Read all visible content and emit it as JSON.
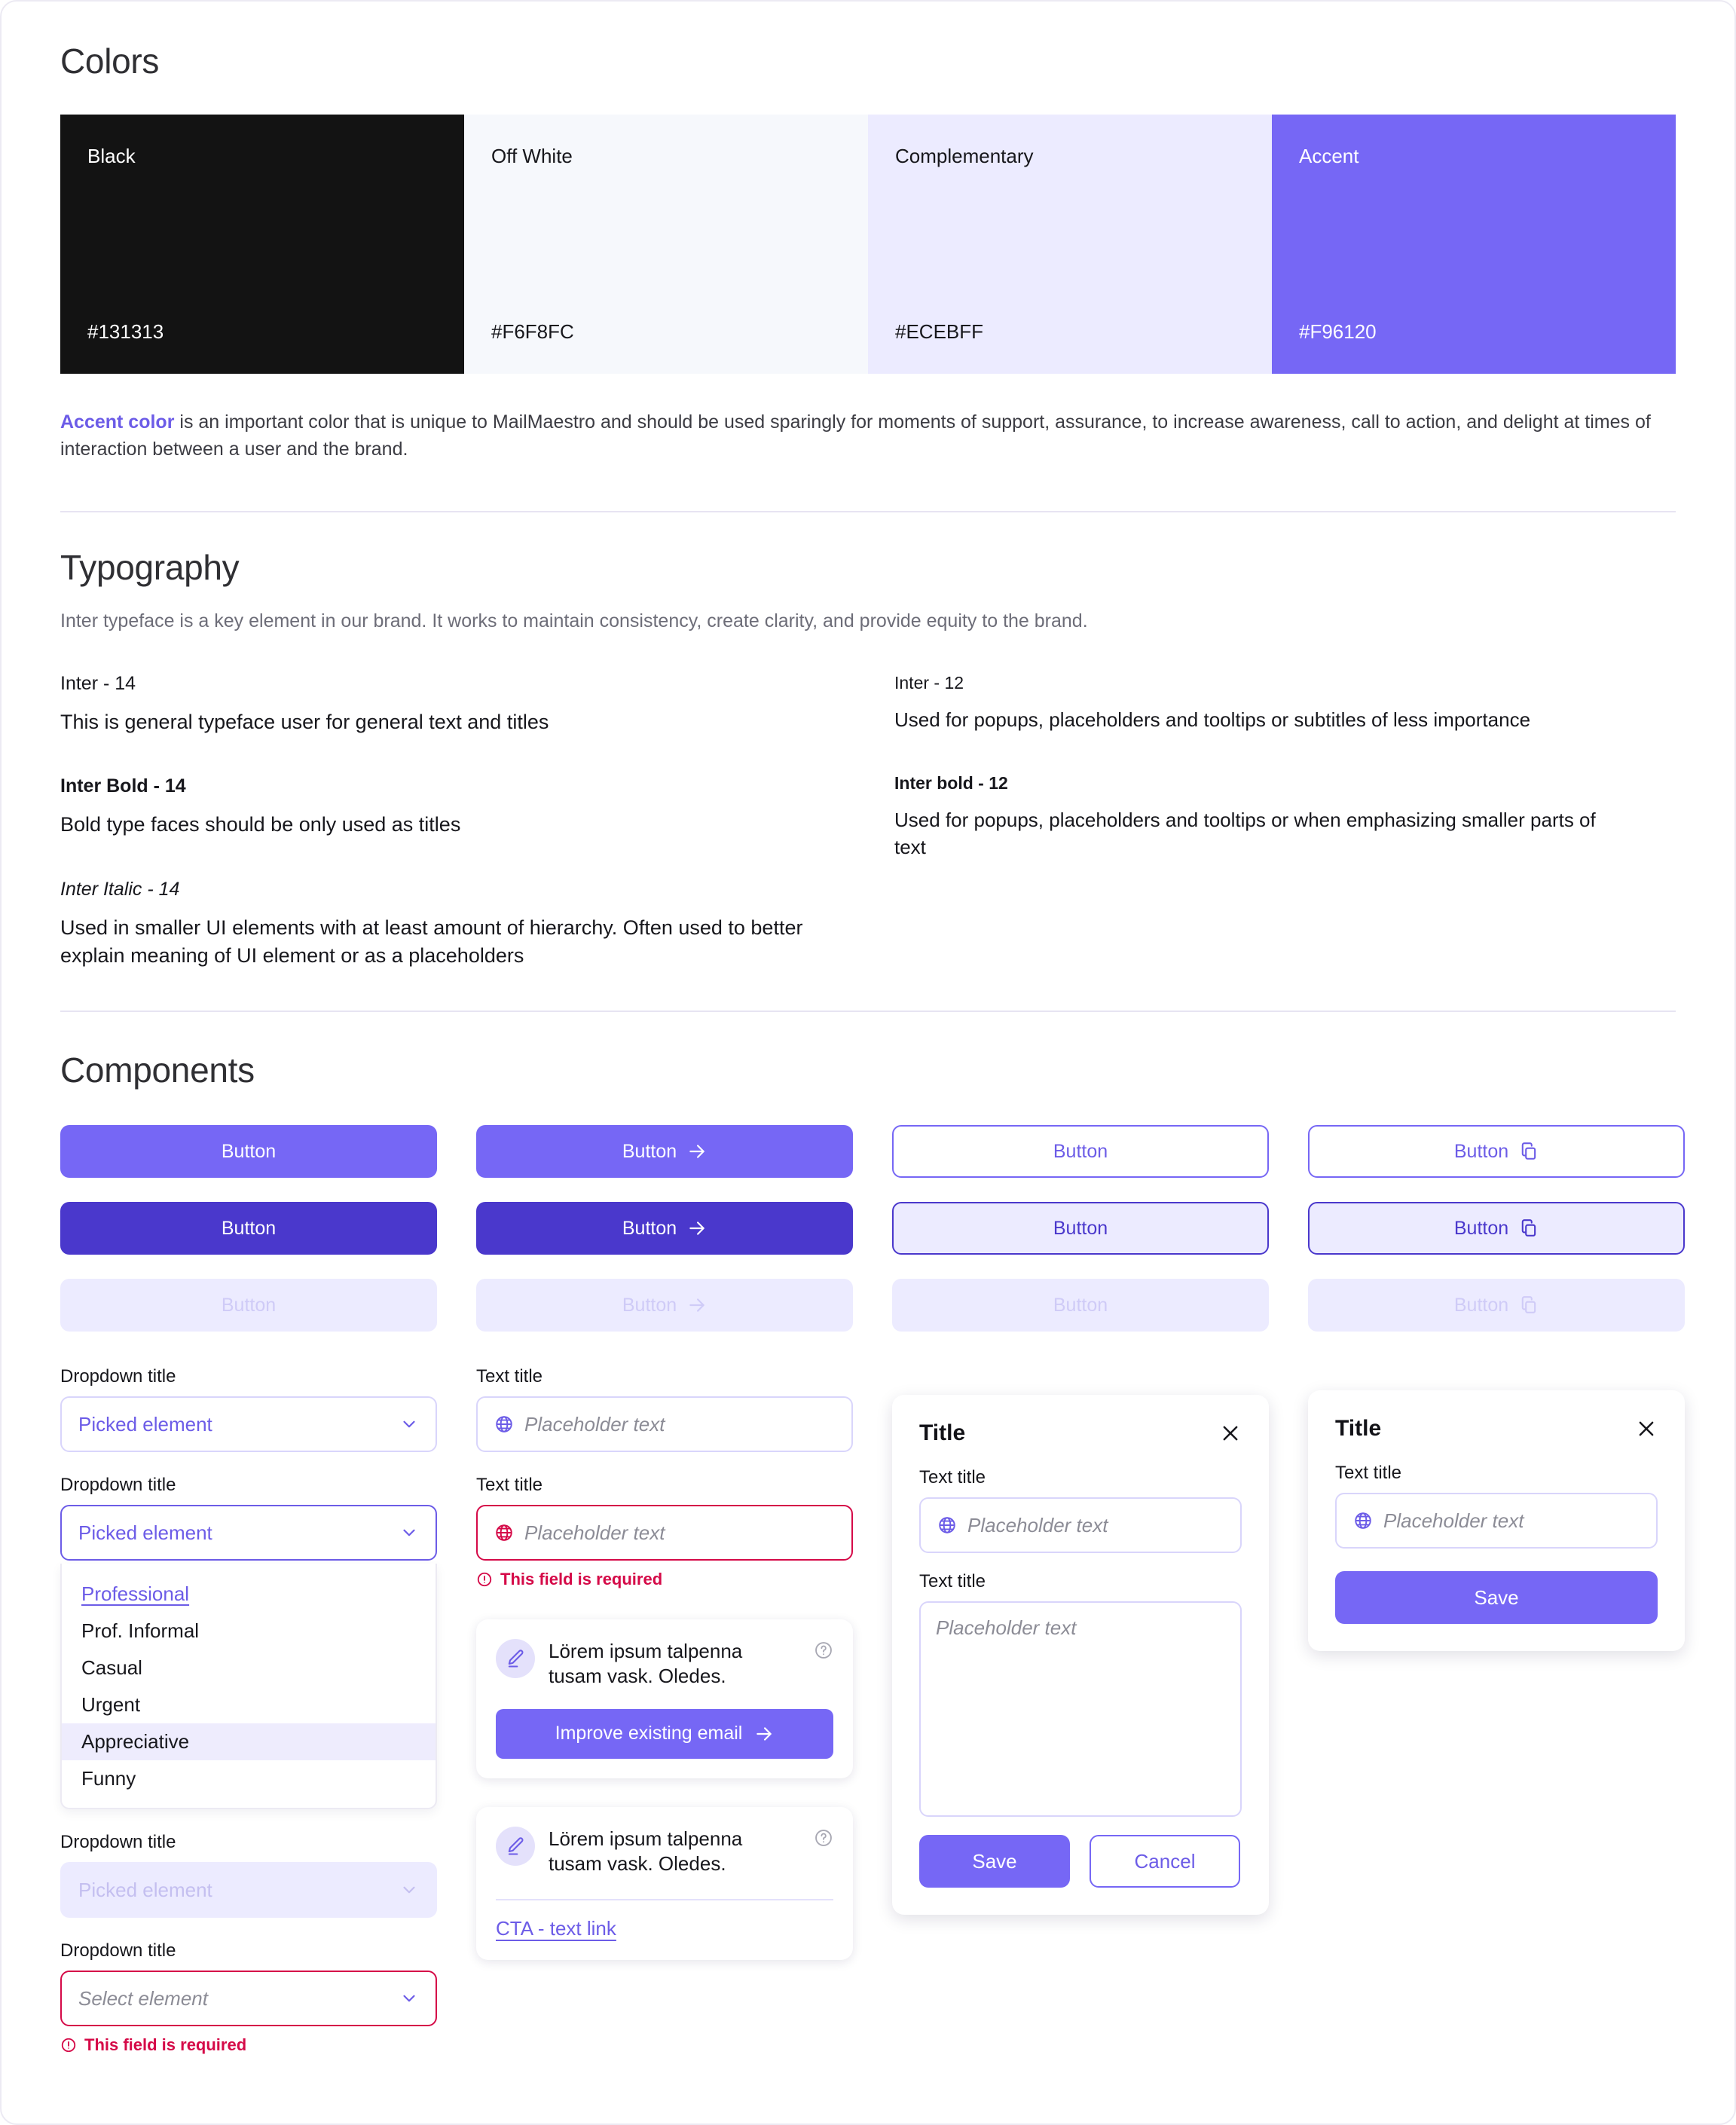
{
  "colors": {
    "heading": "Colors",
    "swatches": [
      {
        "name": "Black",
        "hex": "#131313",
        "bg": "#131313",
        "text": "#ffffff"
      },
      {
        "name": "Off White",
        "hex": "#F6F8FC",
        "bg": "#f6f8fc",
        "text": "#17171c"
      },
      {
        "name": "Complementary",
        "hex": "#ECEBFF",
        "bg": "#ecebff",
        "text": "#17171c"
      },
      {
        "name": "Accent",
        "hex": "#F96120",
        "bg": "#7667f5",
        "text": "#ffffff"
      }
    ],
    "note_link": "Accent color",
    "note_rest": " is an important color that is unique to MailMaestro and should be used sparingly for moments of support, assurance, to increase awareness, call to action, and delight at times of interaction between a user and the brand."
  },
  "typography": {
    "heading": "Typography",
    "intro": "Inter typeface is a key element in our brand. It works to maintain consistency, create clarity, and provide equity to the brand.",
    "left": [
      {
        "label": "Inter - 14",
        "sample": "This is general typeface user for general text and titles"
      },
      {
        "label": "Inter Bold - 14",
        "sample": "Bold type faces should be only used as titles"
      },
      {
        "label": "Inter Italic - 14",
        "sample": "Used in smaller UI elements with at least amount of hierarchy. Often used to better explain meaning of UI element or as a placeholders"
      }
    ],
    "right": [
      {
        "label": "Inter - 12",
        "sample": "Used for popups, placeholders and tooltips or subtitles of less importance"
      },
      {
        "label": "Inter bold - 12",
        "sample": "Used for popups, placeholders and tooltips or when emphasizing smaller parts of text"
      }
    ]
  },
  "components": {
    "heading": "Components",
    "button_label": "Button",
    "buttons": {
      "r1c1": "Button",
      "r1c2": "Button",
      "r1c3": "Button",
      "r1c4": "Button",
      "r2c1": "Button",
      "r2c2": "Button",
      "r2c3": "Button",
      "r2c4": "Button",
      "r3c1": "Button",
      "r3c2": "Button",
      "r3c3": "Button",
      "r3c4": "Button"
    },
    "dropdowns": {
      "title": "Dropdown title",
      "picked": "Picked element",
      "select_placeholder": "Select element",
      "error": "This field is required",
      "options": [
        "Professional",
        "Prof. Informal",
        "Casual",
        "Urgent",
        "Appreciative",
        "Funny"
      ],
      "selected_option": "Professional",
      "hovered_option": "Appreciative"
    },
    "text_fields": {
      "title": "Text title",
      "placeholder": "Placeholder text",
      "error": "This field is required"
    },
    "suggestion_cards": [
      {
        "text": "Lörem ipsum talpenna tusam vask. Oledes.",
        "cta": "Improve existing email"
      },
      {
        "text": "Lörem ipsum talpenna tusam vask. Oledes.",
        "link": "CTA - text link"
      }
    ],
    "modal_large": {
      "title": "Title",
      "field1_label": "Text title",
      "field1_placeholder": "Placeholder text",
      "field2_label": "Text title",
      "field2_placeholder": "Placeholder text",
      "save": "Save",
      "cancel": "Cancel"
    },
    "modal_small": {
      "title": "Title",
      "field1_label": "Text title",
      "field1_placeholder": "Placeholder text",
      "save": "Save"
    }
  }
}
